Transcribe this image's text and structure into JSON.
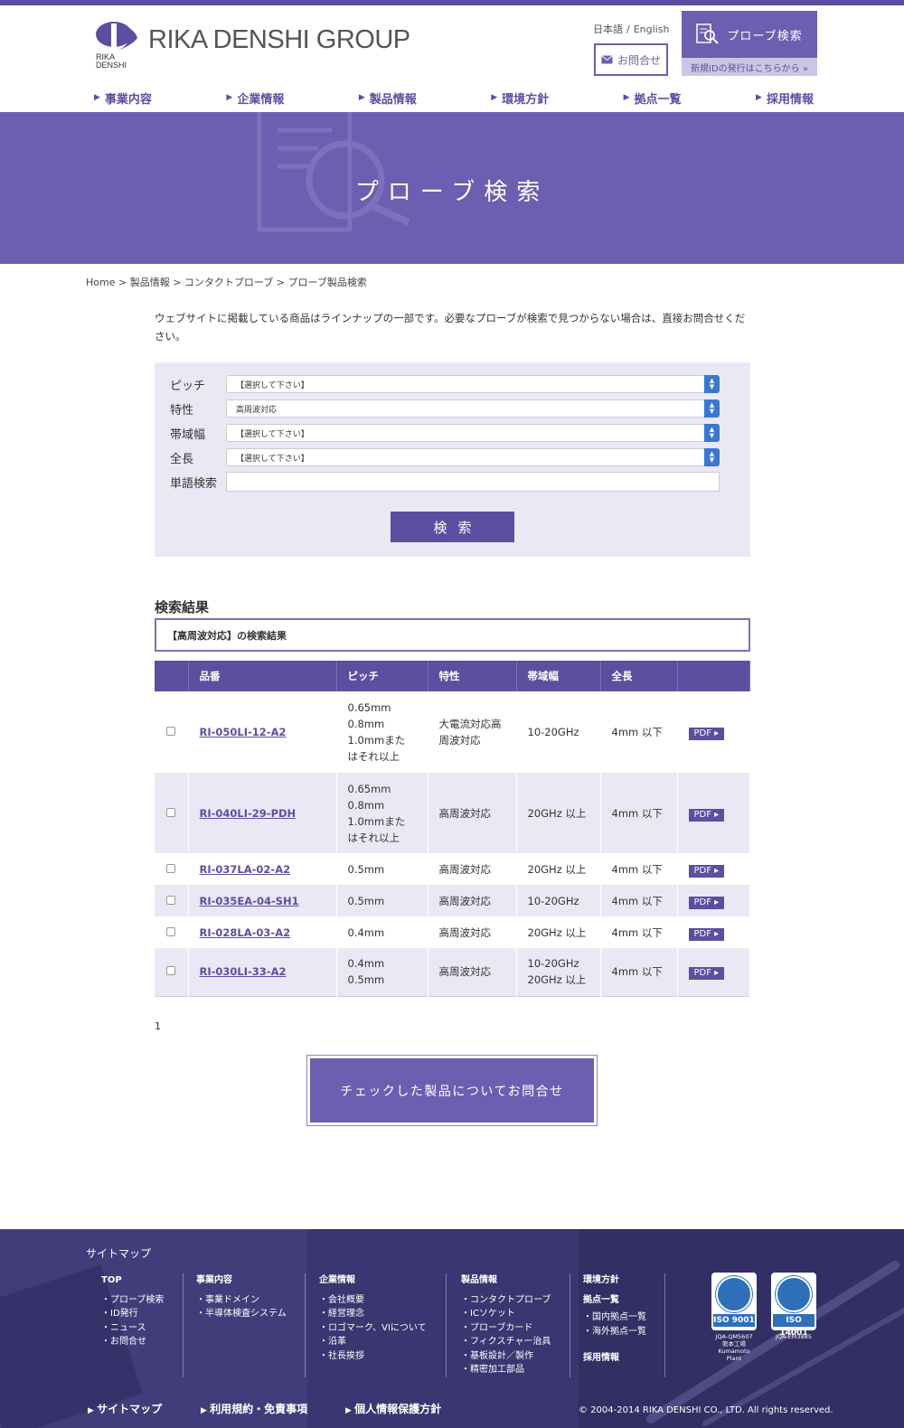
{
  "header": {
    "brand": "RIKA DENSHI GROUP",
    "logo_small_1": "RIKA",
    "logo_small_2": "DENSHI",
    "lang_ja": "日本語",
    "lang_sep": "/",
    "lang_en": "English",
    "contact_label": "お問合せ",
    "probe_search_label": "プローブ検索",
    "new_id_label": "新規IDの発行はこちらから »"
  },
  "nav": [
    "事業内容",
    "企業情報",
    "製品情報",
    "環境方針",
    "拠点一覧",
    "採用情報"
  ],
  "hero": {
    "title": "プローブ検索"
  },
  "breadcrumb": [
    "Home",
    "製品情報",
    "コンタクトプローブ",
    "プローブ製品検索"
  ],
  "intro": "ウェブサイトに掲載している商品はラインナップの一部です。必要なプローブが検索で見つからない場合は、直接お問合せください。",
  "search": {
    "fields": [
      {
        "label": "ピッチ",
        "value": "【選択して下さい】"
      },
      {
        "label": "特性",
        "value": "高周波対応"
      },
      {
        "label": "帯域幅",
        "value": "【選択して下さい】"
      },
      {
        "label": "全長",
        "value": "【選択して下さい】"
      }
    ],
    "keyword_label": "単語検索",
    "keyword_value": "",
    "button": "検索"
  },
  "results": {
    "heading": "検索結果",
    "summary": "【高周波対応】の検索結果",
    "columns": [
      "品番",
      "ピッチ",
      "特性",
      "帯域幅",
      "全長"
    ],
    "rows": [
      {
        "part": "RI-050LI-12-A2",
        "pitch": [
          "0.65mm",
          "0.8mm",
          "1.0mmまた",
          "はそれ以上"
        ],
        "char": [
          "大電流対応高",
          "周波対応"
        ],
        "band": [
          "10-20GHz"
        ],
        "length": "4mm 以下",
        "pdf": "PDF ▸"
      },
      {
        "part": "RI-040LI-29-PDH",
        "pitch": [
          "0.65mm",
          "0.8mm",
          "1.0mmまた",
          "はそれ以上"
        ],
        "char": [
          "高周波対応"
        ],
        "band": [
          "20GHz 以上"
        ],
        "length": "4mm 以下",
        "pdf": "PDF ▸"
      },
      {
        "part": "RI-037LA-02-A2",
        "pitch": [
          "0.5mm"
        ],
        "char": [
          "高周波対応"
        ],
        "band": [
          "20GHz 以上"
        ],
        "length": "4mm 以下",
        "pdf": "PDF ▸"
      },
      {
        "part": "RI-035EA-04-SH1",
        "pitch": [
          "0.5mm"
        ],
        "char": [
          "高周波対応"
        ],
        "band": [
          "10-20GHz"
        ],
        "length": "4mm 以下",
        "pdf": "PDF ▸"
      },
      {
        "part": "RI-028LA-03-A2",
        "pitch": [
          "0.4mm"
        ],
        "char": [
          "高周波対応"
        ],
        "band": [
          "20GHz 以上"
        ],
        "length": "4mm 以下",
        "pdf": "PDF ▸"
      },
      {
        "part": "RI-030LI-33-A2",
        "pitch": [
          "0.4mm",
          "0.5mm"
        ],
        "char": [
          "高周波対応"
        ],
        "band": [
          "10-20GHz",
          "20GHz 以上"
        ],
        "length": "4mm 以下",
        "pdf": "PDF ▸"
      }
    ],
    "pager": "1",
    "inquiry_button": "チェックした製品についてお問合せ"
  },
  "footer": {
    "sitemap_title": "サイトマップ",
    "col1": {
      "head": "TOP",
      "items": [
        "プローブ検索",
        "ID発行",
        "ニュース",
        "お問合せ"
      ]
    },
    "col2": {
      "head": "事業内容",
      "items": [
        "事業ドメイン",
        "半導体検査システム"
      ]
    },
    "col3": {
      "head": "企業情報",
      "items": [
        "会社概要",
        "経営理念",
        "ロゴマーク、VIについて",
        "沿革",
        "社長挨拶"
      ]
    },
    "col4": {
      "head": "製品情報",
      "items": [
        "コンタクトプローブ",
        "ICソケット",
        "プローブカード",
        "フィクスチャー治具",
        "基板設計／製作",
        "精密加工部品"
      ]
    },
    "col5": {
      "head1": "環境方針",
      "head2": "拠点一覧",
      "items": [
        "国内拠点一覧",
        "海外拠点一覧"
      ],
      "head3": "採用情報"
    },
    "iso1": {
      "label": "ISO 9001",
      "code": "JQA-QM5607",
      "sub1": "熊本工場",
      "sub2": "Kumamoto Plant"
    },
    "iso2": {
      "label": "ISO 14001",
      "code": "JQA-EM3885"
    },
    "bottom_links": [
      "サイトマップ",
      "利用規約・免責事項",
      "個人情報保護方針"
    ],
    "copyright": "© 2004-2014 RIKA DENSHI CO., LTD. All rights reserved."
  },
  "colors": {
    "primary": "#5b4fa0",
    "hero": "#6a5fb0",
    "footer": "#3b3571",
    "row_alt": "#e9e9f5"
  }
}
